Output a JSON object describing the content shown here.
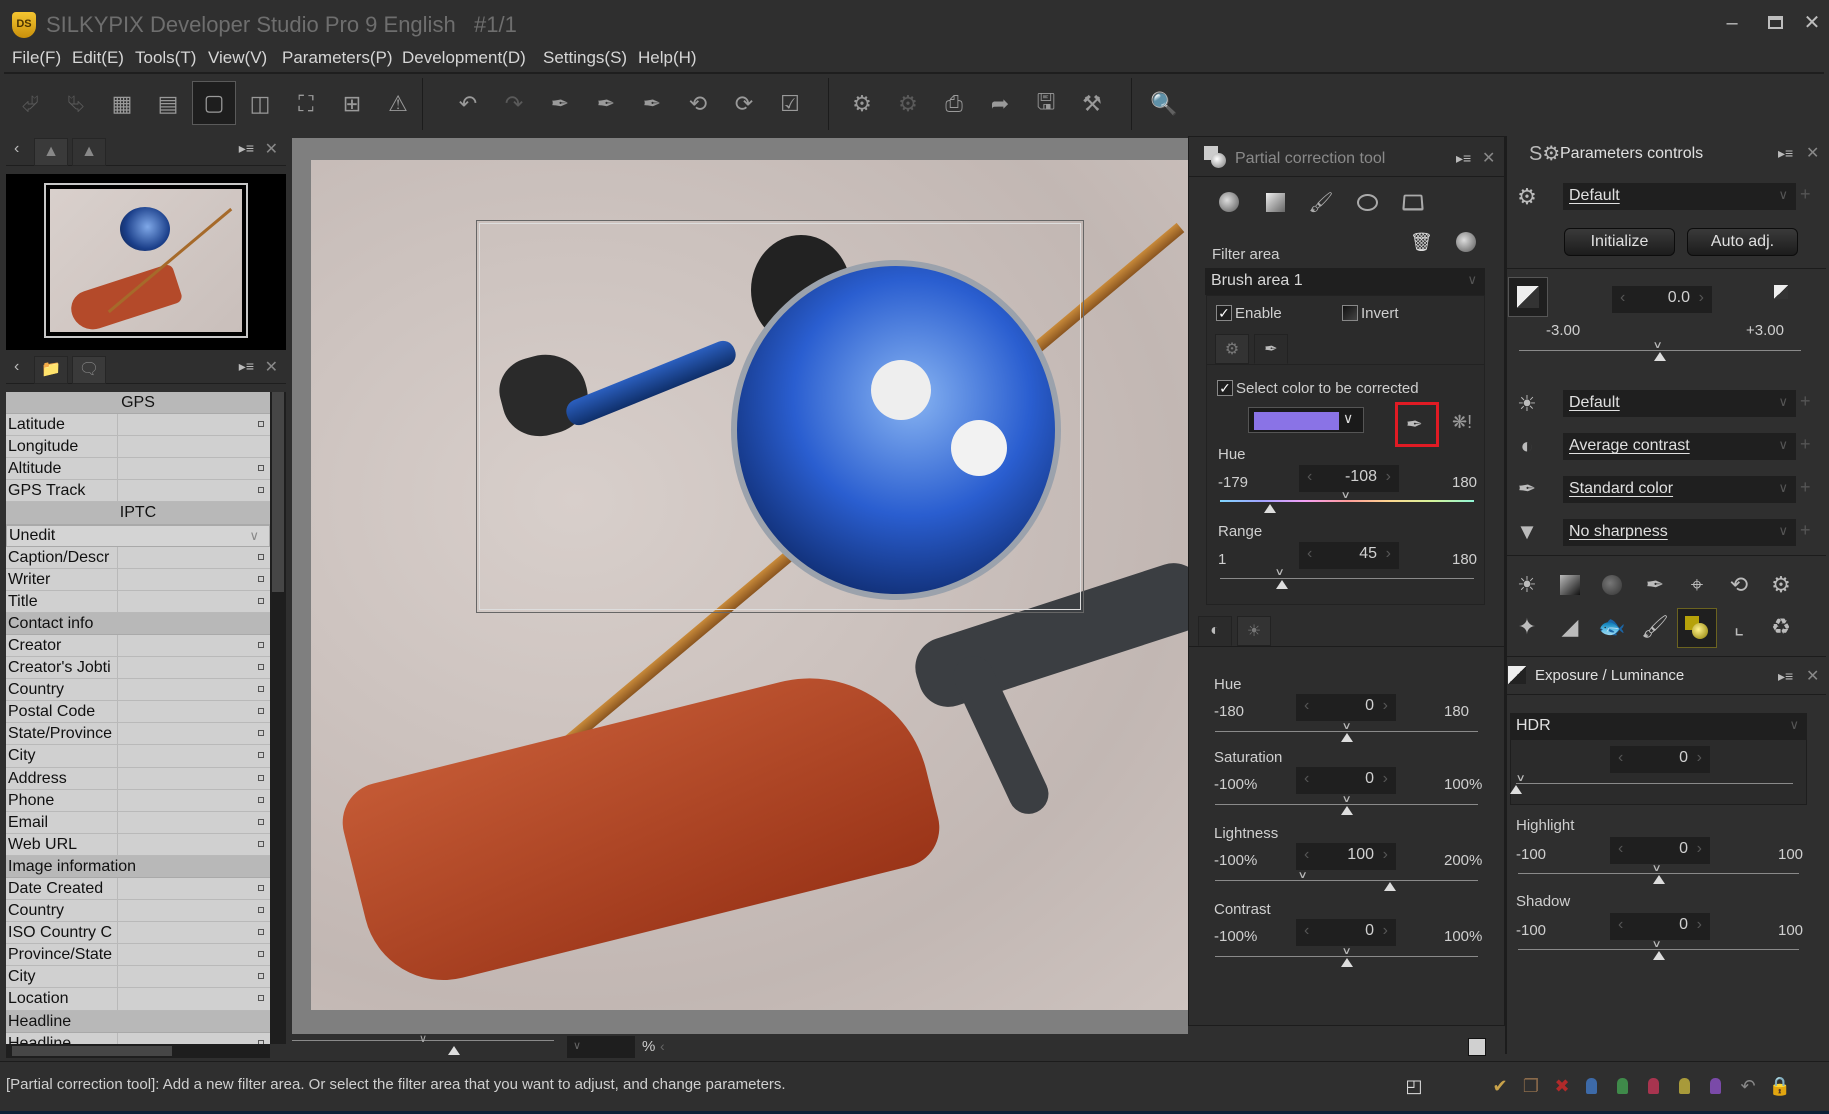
{
  "window": {
    "logo_text": "DS",
    "title": "SILKYPIX Developer Studio Pro 9 English   #1/1",
    "minimize_icon": "minimize-icon",
    "maximize_icon": "maximize-icon",
    "close_icon": "close-icon"
  },
  "menu": [
    {
      "label": "File(F)"
    },
    {
      "label": "Edit(E)"
    },
    {
      "label": "Tools(T)"
    },
    {
      "label": "View(V)"
    },
    {
      "label": "Parameters(P)"
    },
    {
      "label": "Development(D)"
    },
    {
      "label": "Settings(S)"
    },
    {
      "label": "Help(H)"
    }
  ],
  "toolbar": {
    "items": [
      {
        "icon": "previous-image-icon",
        "state": "disabled"
      },
      {
        "icon": "next-image-icon",
        "state": "disabled"
      },
      {
        "icon": "thumbnail-grid-icon"
      },
      {
        "icon": "thumbnail-preview-icon"
      },
      {
        "icon": "single-preview-icon",
        "state": "active"
      },
      {
        "icon": "compare-view-icon"
      },
      {
        "icon": "fullscreen-icon"
      },
      {
        "icon": "grid-overlay-icon"
      },
      {
        "icon": "warning-icon"
      },
      {
        "icon": "undo-icon"
      },
      {
        "icon": "redo-icon",
        "state": "disabled"
      },
      {
        "icon": "white-balance-picker-icon"
      },
      {
        "icon": "gray-balance-picker-icon"
      },
      {
        "icon": "black-point-picker-icon"
      },
      {
        "icon": "rotate-left-icon"
      },
      {
        "icon": "rotate-right-icon"
      },
      {
        "icon": "mark-check-icon"
      },
      {
        "icon": "develop-save-icon"
      },
      {
        "icon": "batch-develop-icon",
        "state": "disabled"
      },
      {
        "icon": "print-icon"
      },
      {
        "icon": "export-icon"
      },
      {
        "icon": "monitor-icon"
      },
      {
        "icon": "tools-hammer-icon"
      },
      {
        "icon": "loupe-icon"
      }
    ]
  },
  "left_panel": {
    "top_tabs": [
      "navigator-tab",
      "histogram-tab"
    ],
    "bottom_tabs": [
      "folder-tab",
      "metadata-tab"
    ],
    "metadata": {
      "sections": [
        {
          "type": "header",
          "align": "center",
          "label": "GPS"
        },
        {
          "type": "row",
          "label": "Latitude",
          "value": "",
          "editable": true
        },
        {
          "type": "row",
          "label": "Longitude",
          "value": "",
          "editable": false
        },
        {
          "type": "row",
          "label": "Altitude",
          "value": "",
          "editable": true
        },
        {
          "type": "row",
          "label": "GPS Track",
          "value": "",
          "editable": true
        },
        {
          "type": "header",
          "align": "center",
          "label": "IPTC"
        },
        {
          "type": "select",
          "label": "Unedit"
        },
        {
          "type": "row",
          "label": "Caption/Descr",
          "value": "",
          "editable": true
        },
        {
          "type": "row",
          "label": "Writer",
          "value": "",
          "editable": true
        },
        {
          "type": "row",
          "label": "Title",
          "value": "",
          "editable": true
        },
        {
          "type": "header",
          "align": "left",
          "label": "Contact info"
        },
        {
          "type": "row",
          "label": "Creator",
          "value": "",
          "editable": true
        },
        {
          "type": "row",
          "label": "Creator's Jobti",
          "value": "",
          "editable": true
        },
        {
          "type": "row",
          "label": "Country",
          "value": "",
          "editable": true
        },
        {
          "type": "row",
          "label": "Postal Code",
          "value": "",
          "editable": true
        },
        {
          "type": "row",
          "label": "State/Province",
          "value": "",
          "editable": true
        },
        {
          "type": "row",
          "label": "City",
          "value": "",
          "editable": true
        },
        {
          "type": "row",
          "label": "Address",
          "value": "",
          "editable": true
        },
        {
          "type": "row",
          "label": "Phone",
          "value": "",
          "editable": true
        },
        {
          "type": "row",
          "label": "Email",
          "value": "",
          "editable": true
        },
        {
          "type": "row",
          "label": "Web URL",
          "value": "",
          "editable": true
        },
        {
          "type": "header",
          "align": "left",
          "label": "Image information"
        },
        {
          "type": "row",
          "label": "Date Created",
          "value": "",
          "editable": true
        },
        {
          "type": "row",
          "label": "Country",
          "value": "",
          "editable": true
        },
        {
          "type": "row",
          "label": "ISO Country C",
          "value": "",
          "editable": true
        },
        {
          "type": "row",
          "label": "Province/State",
          "value": "",
          "editable": true
        },
        {
          "type": "row",
          "label": "City",
          "value": "",
          "editable": true
        },
        {
          "type": "row",
          "label": "Location",
          "value": "",
          "editable": true
        },
        {
          "type": "header",
          "align": "left",
          "label": "Headline"
        },
        {
          "type": "row",
          "label": "Headline",
          "value": "",
          "editable": true
        }
      ]
    }
  },
  "preview": {
    "zoom_value": "",
    "zoom_unit": "%"
  },
  "partial_correction": {
    "title": "Partial correction tool",
    "shape_tools": [
      "circular-gradient-icon",
      "linear-gradient-icon",
      "brush-icon",
      "ellipse-icon",
      "polygon-icon"
    ],
    "filter_area_label": "Filter area",
    "filter_area_value": "Brush area 1",
    "enable_label": "Enable",
    "enable_checked": true,
    "invert_label": "Invert",
    "invert_checked": false,
    "select_color_label": "Select color to be corrected",
    "select_color_checked": true,
    "selected_color": "#8a73e6",
    "hue": {
      "label": "Hue",
      "min": "-179",
      "max": "180",
      "value": "-108",
      "min_num": -179,
      "max_num": 180,
      "num": -108
    },
    "range": {
      "label": "Range",
      "min": "1",
      "max": "180",
      "value": "45",
      "min_num": 1,
      "max_num": 180,
      "num": 45
    },
    "adjustments": [
      {
        "label": "Hue",
        "min": "-180",
        "max": "180",
        "value": "0",
        "min_num": -180,
        "max_num": 180,
        "num": 0
      },
      {
        "label": "Saturation",
        "min": "-100%",
        "max": "100%",
        "value": "0",
        "min_num": -100,
        "max_num": 100,
        "num": 0
      },
      {
        "label": "Lightness",
        "min": "-100%",
        "max": "200%",
        "value": "100",
        "min_num": -100,
        "max_num": 200,
        "num": 100
      },
      {
        "label": "Contrast",
        "min": "-100%",
        "max": "100%",
        "value": "0",
        "min_num": -100,
        "max_num": 100,
        "num": 0
      }
    ]
  },
  "parameters": {
    "title": "Parameters controls",
    "taste": "Default",
    "initialize_label": "Initialize",
    "auto_adj_label": "Auto adj.",
    "exposure": {
      "value": "0.0",
      "min": "-3.00",
      "max": "+3.00",
      "num": 0.0,
      "min_num": -3,
      "max_num": 3
    },
    "white_balance": "Default",
    "tone": "Average contrast",
    "color": "Standard color",
    "sharpness": "No sharpness",
    "tool_icons_row1": [
      "exposure-bias-icon",
      "tone-curve-icon",
      "noise-reduction-icon",
      "color-picker-icon",
      "lens-distortion-icon",
      "rotation-icon",
      "advanced-settings-icon"
    ],
    "tool_icons_row2": [
      "dodge-burn-icon",
      "gradation-icon",
      "fisheye-icon",
      "spot-removal-icon",
      "partial-correction-icon",
      "crop-icon",
      "recycle-icon"
    ]
  },
  "exposure_luminance": {
    "title": "Exposure / Luminance",
    "hdr_label": "HDR",
    "hdr": {
      "value": "0",
      "num": 0,
      "min_num": 0,
      "max_num": 100
    },
    "highlight": {
      "label": "Highlight",
      "min": "-100",
      "max": "100",
      "value": "0",
      "num": 0,
      "min_num": -100,
      "max_num": 100
    },
    "shadow": {
      "label": "Shadow",
      "min": "-100",
      "max": "100",
      "value": "0",
      "num": 0,
      "min_num": -100,
      "max_num": 100
    }
  },
  "status": {
    "message": "[Partial correction tool]: Add a new filter area. Or select the filter area that you want to adjust, and change parameters.",
    "icons": [
      {
        "name": "page-icon",
        "color": "#dddddd"
      },
      {
        "name": "check-mark-icon",
        "color": "#c8a24a"
      },
      {
        "name": "copy-icon",
        "color": "#8a6a4a"
      },
      {
        "name": "reject-icon",
        "color": "#b02a2a"
      },
      {
        "name": "blue-tag-icon",
        "color": "#3d6aa8"
      },
      {
        "name": "green-tag-icon",
        "color": "#3f8a4a"
      },
      {
        "name": "red-tag-icon",
        "color": "#a8344f"
      },
      {
        "name": "yellow-tag-icon",
        "color": "#a89a3a"
      },
      {
        "name": "purple-tag-icon",
        "color": "#7a4aa8"
      },
      {
        "name": "revert-icon",
        "color": "#888888"
      },
      {
        "name": "lock-icon",
        "color": "#8a7a5a"
      }
    ]
  }
}
